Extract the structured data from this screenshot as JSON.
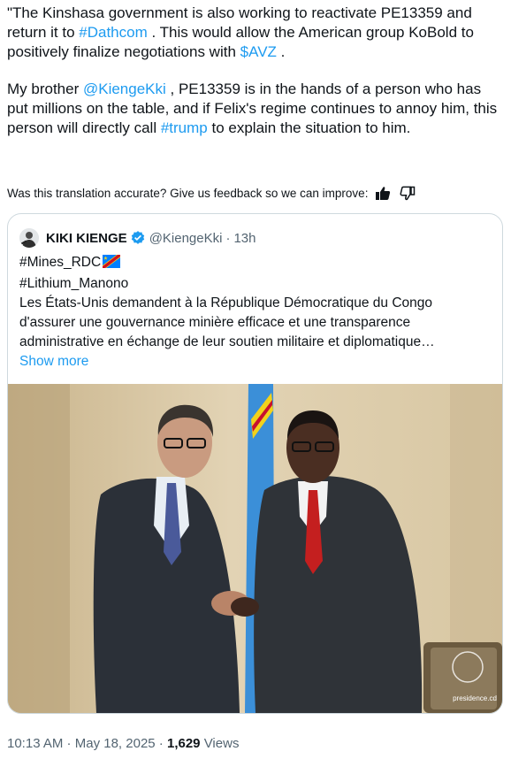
{
  "tweet": {
    "para1": {
      "t1": "\"The Kinshasa government is also working to reactivate PE13359 and return it to ",
      "l1": "#Dathcom",
      "t2": " . This would allow the American group KoBold to positively finalize negotiations with ",
      "l2": "$AVZ",
      "t3": " ."
    },
    "para2": {
      "t1": "My brother ",
      "l1": "@KiengeKki",
      "t2": " , PE13359 is in the hands of a person who has put millions on the table, and if Felix's regime continues to annoy him, this person will directly call ",
      "l2": "#trump",
      "t3": " to explain the situation to him."
    }
  },
  "feedback": {
    "text": "Was this translation accurate? Give us feedback so we can improve:",
    "thumbs_up_icon": "thumbs-up-icon",
    "thumbs_down_icon": "thumbs-down-icon"
  },
  "quoted": {
    "name": "KIKI KIENGE",
    "handle": "@KiengeKki",
    "separator": "·",
    "time": "13h",
    "line1": "#Mines_RDC",
    "line2": "#Lithium_Manono",
    "line3": " Les États-Unis demandent à la République Démocratique du Congo",
    "line4": "d'assurer une gouvernance minière efficace et une transparence",
    "line5": "administrative en échange de leur soutien militaire et diplomatique…",
    "show_more": "Show more",
    "photo_watermark": "presidence.cd"
  },
  "meta": {
    "time": "10:13 AM",
    "sep1": " · ",
    "date": "May 18, 2025",
    "sep2": " · ",
    "views_count": "1,629",
    "views_label": " Views"
  },
  "colors": {
    "link": "#1d9bf0",
    "text": "#0f1419",
    "muted": "#536471",
    "border": "#cfd9de"
  }
}
